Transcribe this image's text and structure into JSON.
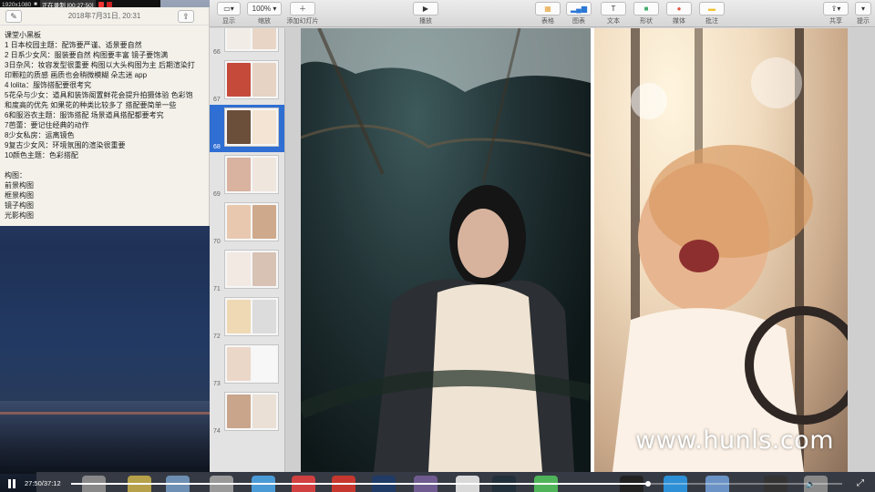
{
  "recorder": {
    "resolution": "1920x1080",
    "status": "正在录制 [00:27:50]"
  },
  "notes": {
    "date": "2018年7月31日, 20:31",
    "lines": [
      "课堂小黑板",
      "1 日本校园主题：配饰要严谨、适景要自然",
      "2 日系少女风：服装要自然 构图要丰富 镜子要饱满",
      "3日杂风：妆容发型很重要 构图以大头构图为主 后期渲染打",
      "印颗粒的质感 画质也会稍微模糊 朵志迷 app",
      "4 lolita：服饰搭配要很考究",
      "5花朵与少女：道具和装饰阁置鲜花会提升拍摄体验 色彩饱",
      "和度高的优先 如果花的种类比较多了 搭配要简单一些",
      "6和服浴衣主题：服饰搭配 场景道具搭配都要考究",
      "7芭蕾：要记住经典的动作",
      "8少女私房：运离镜色",
      "9复古少女风：环境氛围的渲染很重要",
      "10颜色主题：色彩搭配",
      "",
      "构图：",
      "前景构图",
      "框景构图",
      "镜子构图",
      "光影构图"
    ]
  },
  "toolbar": {
    "view_label": "显示",
    "zoom_value": "100%",
    "zoom_label": "缩放",
    "add_slide_label": "添加幻灯片",
    "play_label": "播放",
    "table_label": "表格",
    "chart_label": "图表",
    "text_label": "文本",
    "shape_label": "形状",
    "media_label": "媒体",
    "comment_label": "批注",
    "share_label": "共享",
    "tips_label": "提示"
  },
  "navigator": {
    "slides": [
      {
        "num": "66",
        "selected": false
      },
      {
        "num": "67",
        "selected": false
      },
      {
        "num": "68",
        "selected": true
      },
      {
        "num": "69",
        "selected": false
      },
      {
        "num": "70",
        "selected": false
      },
      {
        "num": "71",
        "selected": false
      },
      {
        "num": "72",
        "selected": false
      },
      {
        "num": "73",
        "selected": false
      },
      {
        "num": "74",
        "selected": false
      }
    ]
  },
  "watermark": "www.hunls.com",
  "player": {
    "time": "27:50/37:12",
    "progress": 0.748
  },
  "colors": {
    "selection": "#2f6ed3",
    "accent_green": "#58b86a"
  }
}
